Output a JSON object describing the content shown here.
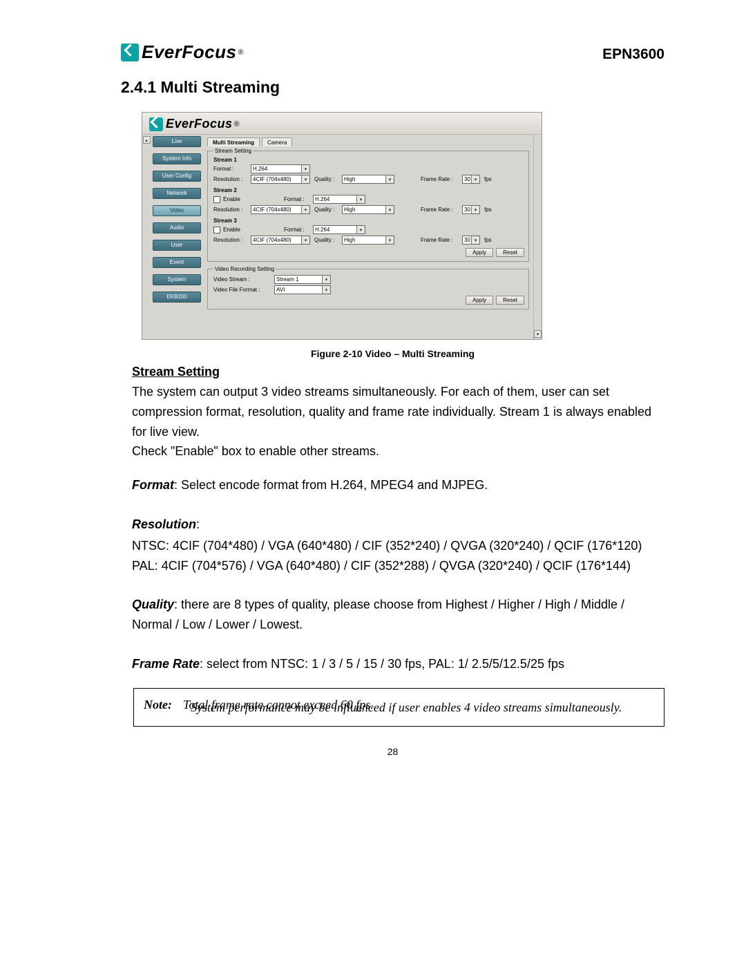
{
  "header": {
    "brand": "EverFocus",
    "registered": "®",
    "model": "EPN3600"
  },
  "section_title": "2.4.1 Multi Streaming",
  "screenshot": {
    "brand": "EverFocus",
    "registered": "®",
    "sidebar": [
      "Live",
      "System Info",
      "User Config",
      "Network",
      "Video",
      "Audio",
      "User",
      "Event",
      "System",
      "EKB200"
    ],
    "sidebar_active_index": 4,
    "tabs": [
      {
        "label": "Multi Streaming",
        "active": true
      },
      {
        "label": "Camera",
        "active": false
      }
    ],
    "stream_setting_legend": "Stream Setting",
    "streams": [
      {
        "title": "Stream 1",
        "rows": [
          {
            "type": "format_only",
            "format_label": "Format :",
            "format_value": "H.264"
          },
          {
            "type": "full",
            "res_label": "Resolution :",
            "res_value": "4CIF (704x480)",
            "quality_label": "Quality :",
            "quality_value": "High",
            "frame_label": "Frame Rate :",
            "frame_value": "30",
            "fps": "fps"
          }
        ]
      },
      {
        "title": "Stream 2",
        "rows": [
          {
            "type": "enable",
            "enable_label": "Enable",
            "format_label": "Format :",
            "format_value": "H.264"
          },
          {
            "type": "full",
            "res_label": "Resolution :",
            "res_value": "4CIF (704x480)",
            "quality_label": "Quality :",
            "quality_value": "High",
            "frame_label": "Frame Rate :",
            "frame_value": "30",
            "fps": "fps"
          }
        ]
      },
      {
        "title": "Stream 3",
        "rows": [
          {
            "type": "enable",
            "enable_label": "Enable",
            "format_label": "Format :",
            "format_value": "H.264"
          },
          {
            "type": "full",
            "res_label": "Resolution :",
            "res_value": "4CIF (704x480)",
            "quality_label": "Quality :",
            "quality_value": "High",
            "frame_label": "Frame Rate :",
            "frame_value": "30",
            "fps": "fps"
          }
        ]
      }
    ],
    "stream_buttons": {
      "apply": "Apply",
      "reset": "Reset"
    },
    "video_recording_legend": "Video Recording Setting",
    "video_recording": {
      "stream_label": "Video Stream :",
      "stream_value": "Stream 1",
      "file_label": "Video File Format :",
      "file_value": "AVI"
    },
    "vr_buttons": {
      "apply": "Apply",
      "reset": "Reset"
    }
  },
  "caption": "Figure 2-10 Video – Multi Streaming",
  "stream_setting_heading": "Stream Setting",
  "paragraph1": "The system can output 3 video streams simultaneously. For each of them, user can set compression format, resolution, quality and frame rate individually. Stream 1 is always enabled for live view.\nCheck \"Enable\" box to enable other streams.",
  "format_label": "Format",
  "format_text": ": Select encode format from H.264, MPEG4 and MJPEG.",
  "resolution_label": "Resolution",
  "resolution_colon": ":",
  "resolution_text": "NTSC: 4CIF (704*480) / VGA (640*480) / CIF (352*240) / QVGA (320*240) / QCIF (176*120)\nPAL: 4CIF (704*576) / VGA (640*480) / CIF (352*288) / QVGA (320*240) / QCIF (176*144)",
  "quality_label": "Quality",
  "quality_text": ": there are 8 types of quality, please choose from Highest / Higher / High / Middle / Normal / Low / Lower / Lowest.",
  "framerate_label": "Frame Rate",
  "framerate_text": ": select from NTSC: 1 / 3 / 5 / 15 / 30 fps, PAL: 1/ 2.5/5/12.5/25 fps",
  "note": {
    "label": "Note:",
    "line1": "Total frame rate cannot exceed 60 fps.",
    "line2": "System performance may be influenced if user enables 4 video streams simultaneously."
  },
  "page_number": "28"
}
